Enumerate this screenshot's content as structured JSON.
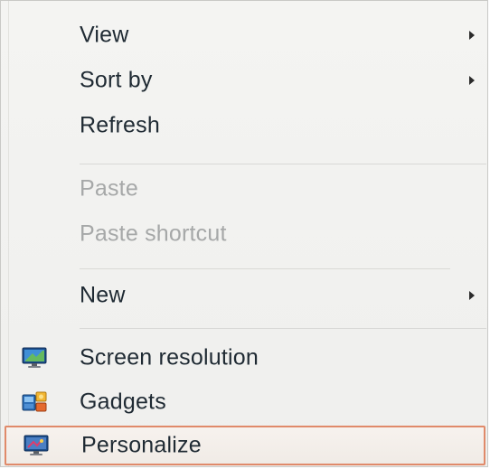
{
  "menu": {
    "items": [
      {
        "label": "View",
        "submenu": true,
        "enabled": true
      },
      {
        "label": "Sort by",
        "submenu": true,
        "enabled": true
      },
      {
        "label": "Refresh",
        "submenu": false,
        "enabled": true
      },
      {
        "label": "Paste",
        "submenu": false,
        "enabled": false
      },
      {
        "label": "Paste shortcut",
        "submenu": false,
        "enabled": false
      },
      {
        "label": "New",
        "submenu": true,
        "enabled": true
      },
      {
        "label": "Screen resolution",
        "submenu": false,
        "enabled": true,
        "icon": "monitor-icon"
      },
      {
        "label": "Gadgets",
        "submenu": false,
        "enabled": true,
        "icon": "gadgets-icon"
      },
      {
        "label": "Personalize",
        "submenu": false,
        "enabled": true,
        "icon": "personalize-icon",
        "highlighted": true
      }
    ]
  },
  "colors": {
    "highlight_border": "#e08a6a",
    "text": "#1f2a33",
    "disabled_text": "#a6a8a8"
  }
}
